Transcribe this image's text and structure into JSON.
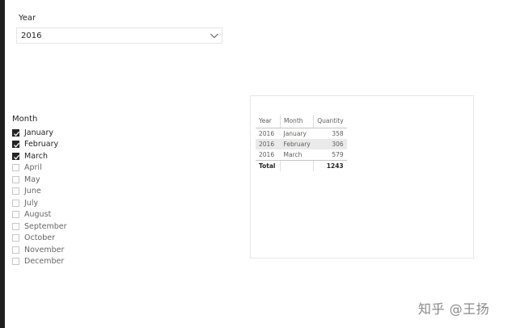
{
  "year_slicer": {
    "title": "Year",
    "selected": "2016"
  },
  "month_slicer": {
    "title": "Month",
    "items": [
      {
        "label": "January",
        "checked": true
      },
      {
        "label": "February",
        "checked": true
      },
      {
        "label": "March",
        "checked": true
      },
      {
        "label": "April",
        "checked": false
      },
      {
        "label": "May",
        "checked": false
      },
      {
        "label": "June",
        "checked": false
      },
      {
        "label": "July",
        "checked": false
      },
      {
        "label": "August",
        "checked": false
      },
      {
        "label": "September",
        "checked": false
      },
      {
        "label": "October",
        "checked": false
      },
      {
        "label": "November",
        "checked": false
      },
      {
        "label": "December",
        "checked": false
      }
    ]
  },
  "table": {
    "headers": [
      "Year",
      "Month",
      "Quantity"
    ],
    "rows": [
      [
        "2016",
        "January",
        "358"
      ],
      [
        "2016",
        "February",
        "306"
      ],
      [
        "2016",
        "March",
        "579"
      ]
    ],
    "total": {
      "label": "Total",
      "month": "",
      "quantity": "1243"
    }
  },
  "watermark": "知乎 @王扬",
  "colors": {
    "checked": "#252423",
    "row_shade": "#eaeaea",
    "border": "#e6e6e6"
  }
}
